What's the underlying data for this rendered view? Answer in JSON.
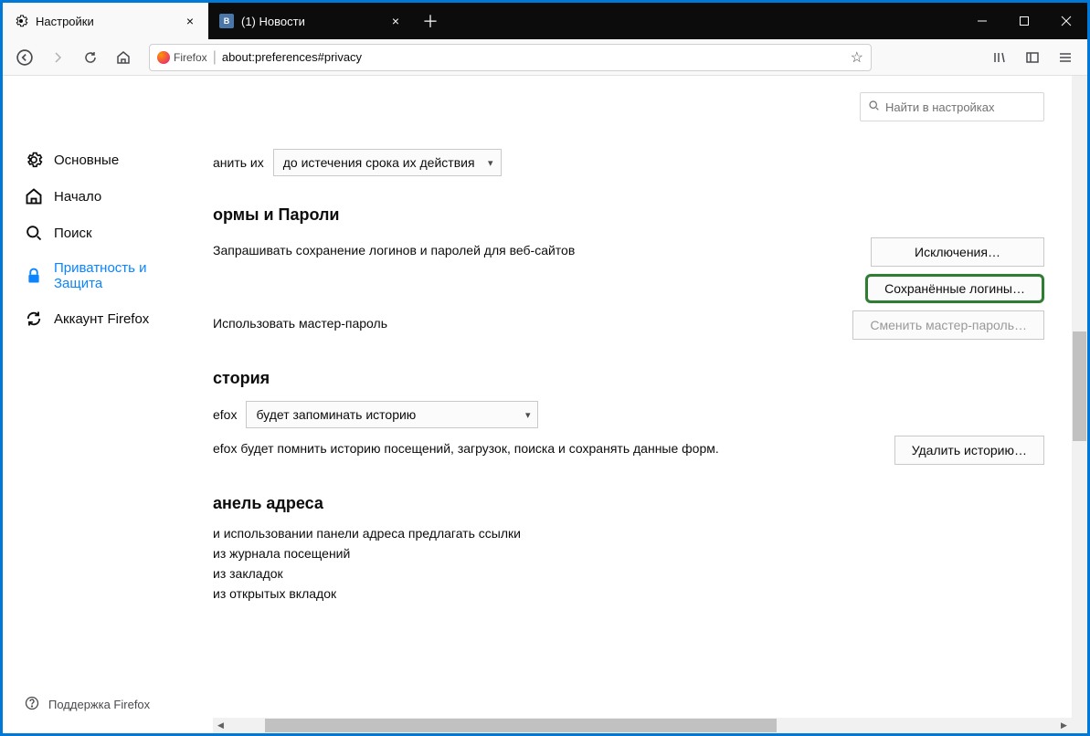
{
  "tabs": [
    {
      "label": "Настройки",
      "icon": "gear"
    },
    {
      "label": "(1) Новости",
      "icon": "vk"
    }
  ],
  "urlbar": {
    "identity": "Firefox",
    "url": "about:preferences#privacy"
  },
  "search": {
    "placeholder": "Найти в настройках"
  },
  "sidebar": {
    "items": [
      {
        "label": "Основные"
      },
      {
        "label": "Начало"
      },
      {
        "label": "Поиск"
      },
      {
        "label": "Приватность и Защита"
      },
      {
        "label": "Аккаунт Firefox"
      }
    ],
    "support": "Поддержка Firefox"
  },
  "cookies": {
    "keep_fragment": "анить их",
    "keep_option": "до истечения срока их действия"
  },
  "forms": {
    "heading": "ормы и Пароли",
    "ask_save": "Запрашивать сохранение логинов и паролей для веб-сайтов",
    "use_master": "Использовать мастер-пароль",
    "btn_exceptions": "Исключения…",
    "btn_saved": "Сохранённые логины…",
    "btn_changemaster": "Сменить мастер-пароль…"
  },
  "history": {
    "heading": "стория",
    "prefix": "efox",
    "option": "будет запоминать историю",
    "desc": "efox будет помнить историю посещений, загрузок, поиска и сохранять данные форм.",
    "btn_clear": "Удалить историю…"
  },
  "addressbar": {
    "heading": "анель адреса",
    "intro": "и использовании панели адреса предлагать ссылки",
    "opt_history": "из журнала посещений",
    "opt_bookmarks": "из закладок",
    "opt_tabs": "из открытых вкладок"
  }
}
